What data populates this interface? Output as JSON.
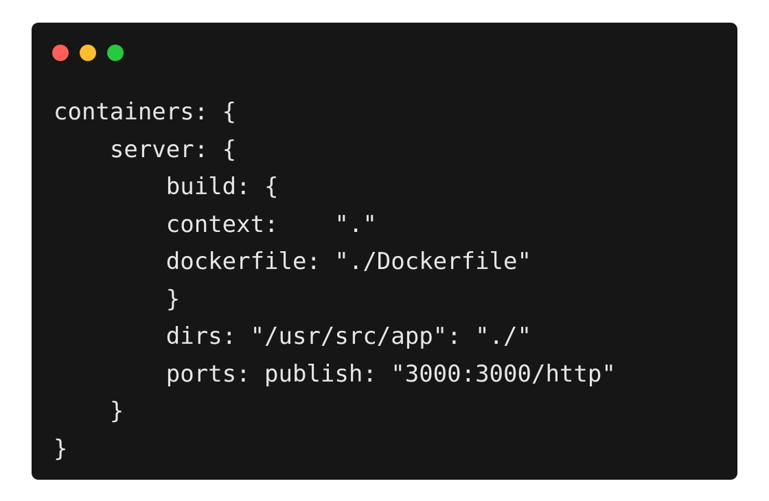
{
  "window": {
    "controls": [
      {
        "name": "close",
        "color": "#ff5f57"
      },
      {
        "name": "minimize",
        "color": "#febc2e"
      },
      {
        "name": "zoom",
        "color": "#28c840"
      }
    ]
  },
  "code": {
    "lines": [
      "containers: {",
      "    server: {",
      "        build: {",
      "        context:    \".\"",
      "        dockerfile: \"./Dockerfile\"",
      "        }",
      "        dirs: \"/usr/src/app\": \"./\"",
      "        ports: publish: \"3000:3000/http\"",
      "    }",
      "}"
    ]
  },
  "colors": {
    "background": "#ffffff",
    "window": "#161616",
    "text": "#e6e6e6"
  }
}
